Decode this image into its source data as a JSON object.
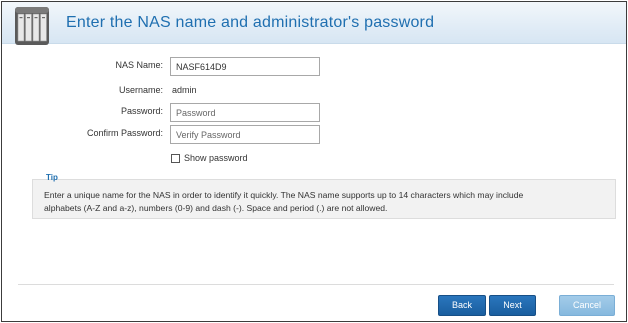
{
  "header": {
    "title": "Enter the NAS name and administrator's password"
  },
  "form": {
    "nas_name": {
      "label": "NAS Name:",
      "value": "NASF614D9"
    },
    "username": {
      "label": "Username:",
      "value": "admin"
    },
    "password": {
      "label": "Password:",
      "placeholder": "Password",
      "value": ""
    },
    "confirm_password": {
      "label": "Confirm Password:",
      "placeholder": "Verify Password",
      "value": ""
    },
    "show_password": {
      "label": "Show password",
      "checked": false
    }
  },
  "tip": {
    "title": "Tip",
    "line1": "Enter a unique name for the NAS in order to identify it quickly. The NAS name supports up to 14 characters which may include",
    "line2": "alphabets (A-Z and a-z), numbers (0-9) and dash (-). Space and period (.) are not allowed."
  },
  "footer": {
    "back_label": "Back",
    "next_label": "Next",
    "cancel_label": "Cancel"
  },
  "colors": {
    "title": "#1f6fb0",
    "primary_button": "#1f68ad",
    "cancel_button": "#95c3e4"
  },
  "icons": {
    "header": "nas-device-icon"
  }
}
